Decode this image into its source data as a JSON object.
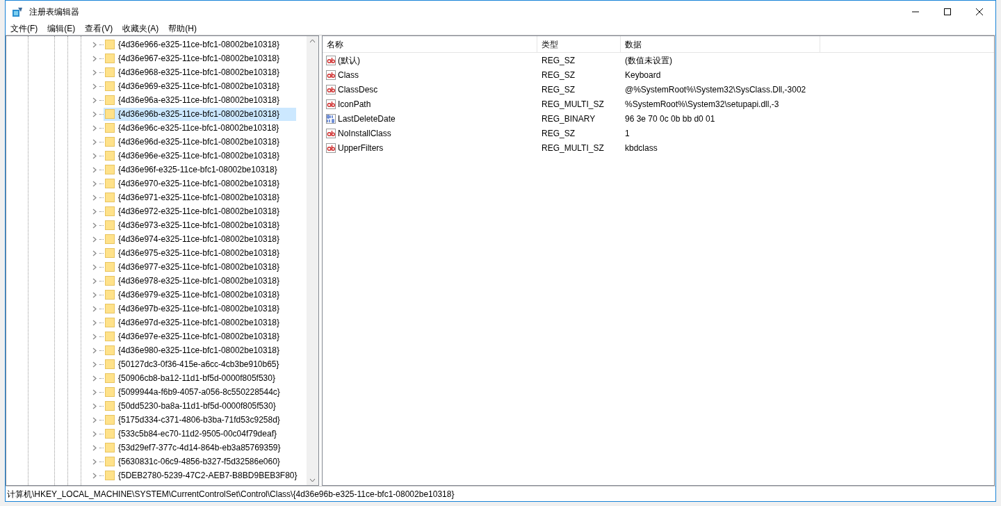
{
  "window": {
    "title": "注册表编辑器"
  },
  "menu": [
    "文件(F)",
    "编辑(E)",
    "查看(V)",
    "收藏夹(A)",
    "帮助(H)"
  ],
  "tree": [
    {
      "label": "{4d36e966-e325-11ce-bfc1-08002be10318}",
      "selected": false
    },
    {
      "label": "{4d36e967-e325-11ce-bfc1-08002be10318}",
      "selected": false
    },
    {
      "label": "{4d36e968-e325-11ce-bfc1-08002be10318}",
      "selected": false
    },
    {
      "label": "{4d36e969-e325-11ce-bfc1-08002be10318}",
      "selected": false
    },
    {
      "label": "{4d36e96a-e325-11ce-bfc1-08002be10318}",
      "selected": false
    },
    {
      "label": "{4d36e96b-e325-11ce-bfc1-08002be10318}",
      "selected": true
    },
    {
      "label": "{4d36e96c-e325-11ce-bfc1-08002be10318}",
      "selected": false
    },
    {
      "label": "{4d36e96d-e325-11ce-bfc1-08002be10318}",
      "selected": false
    },
    {
      "label": "{4d36e96e-e325-11ce-bfc1-08002be10318}",
      "selected": false
    },
    {
      "label": "{4d36e96f-e325-11ce-bfc1-08002be10318}",
      "selected": false
    },
    {
      "label": "{4d36e970-e325-11ce-bfc1-08002be10318}",
      "selected": false
    },
    {
      "label": "{4d36e971-e325-11ce-bfc1-08002be10318}",
      "selected": false
    },
    {
      "label": "{4d36e972-e325-11ce-bfc1-08002be10318}",
      "selected": false
    },
    {
      "label": "{4d36e973-e325-11ce-bfc1-08002be10318}",
      "selected": false
    },
    {
      "label": "{4d36e974-e325-11ce-bfc1-08002be10318}",
      "selected": false
    },
    {
      "label": "{4d36e975-e325-11ce-bfc1-08002be10318}",
      "selected": false
    },
    {
      "label": "{4d36e977-e325-11ce-bfc1-08002be10318}",
      "selected": false
    },
    {
      "label": "{4d36e978-e325-11ce-bfc1-08002be10318}",
      "selected": false
    },
    {
      "label": "{4d36e979-e325-11ce-bfc1-08002be10318}",
      "selected": false
    },
    {
      "label": "{4d36e97b-e325-11ce-bfc1-08002be10318}",
      "selected": false
    },
    {
      "label": "{4d36e97d-e325-11ce-bfc1-08002be10318}",
      "selected": false
    },
    {
      "label": "{4d36e97e-e325-11ce-bfc1-08002be10318}",
      "selected": false
    },
    {
      "label": "{4d36e980-e325-11ce-bfc1-08002be10318}",
      "selected": false
    },
    {
      "label": "{50127dc3-0f36-415e-a6cc-4cb3be910b65}",
      "selected": false
    },
    {
      "label": "{50906cb8-ba12-11d1-bf5d-0000f805f530}",
      "selected": false
    },
    {
      "label": "{5099944a-f6b9-4057-a056-8c550228544c}",
      "selected": false
    },
    {
      "label": "{50dd5230-ba8a-11d1-bf5d-0000f805f530}",
      "selected": false
    },
    {
      "label": "{5175d334-c371-4806-b3ba-71fd53c9258d}",
      "selected": false
    },
    {
      "label": "{533c5b84-ec70-11d2-9505-00c04f79deaf}",
      "selected": false
    },
    {
      "label": "{53d29ef7-377c-4d14-864b-eb3a85769359}",
      "selected": false
    },
    {
      "label": "{5630831c-06c9-4856-b327-f5d32586e060}",
      "selected": false
    },
    {
      "label": "{5DEB2780-5239-47C2-AEB7-B8BD9BEB3F80}",
      "selected": false
    }
  ],
  "table": {
    "columns": [
      "名称",
      "类型",
      "数据"
    ],
    "rows": [
      {
        "kind": "string",
        "name": "(默认)",
        "type": "REG_SZ",
        "data": "(数值未设置)"
      },
      {
        "kind": "string",
        "name": "Class",
        "type": "REG_SZ",
        "data": "Keyboard"
      },
      {
        "kind": "string",
        "name": "ClassDesc",
        "type": "REG_SZ",
        "data": "@%SystemRoot%\\System32\\SysClass.Dll,-3002"
      },
      {
        "kind": "string",
        "name": "IconPath",
        "type": "REG_MULTI_SZ",
        "data": "%SystemRoot%\\System32\\setupapi.dll,-3"
      },
      {
        "kind": "binary",
        "name": "LastDeleteDate",
        "type": "REG_BINARY",
        "data": "96 3e 70 0c 0b bb d0 01"
      },
      {
        "kind": "string",
        "name": "NoInstallClass",
        "type": "REG_SZ",
        "data": "1"
      },
      {
        "kind": "string",
        "name": "UpperFilters",
        "type": "REG_MULTI_SZ",
        "data": "kbdclass"
      }
    ]
  },
  "status_bar": "计算机\\HKEY_LOCAL_MACHINE\\SYSTEM\\CurrentControlSet\\Control\\Class\\{4d36e96b-e325-11ce-bfc1-08002be10318}"
}
